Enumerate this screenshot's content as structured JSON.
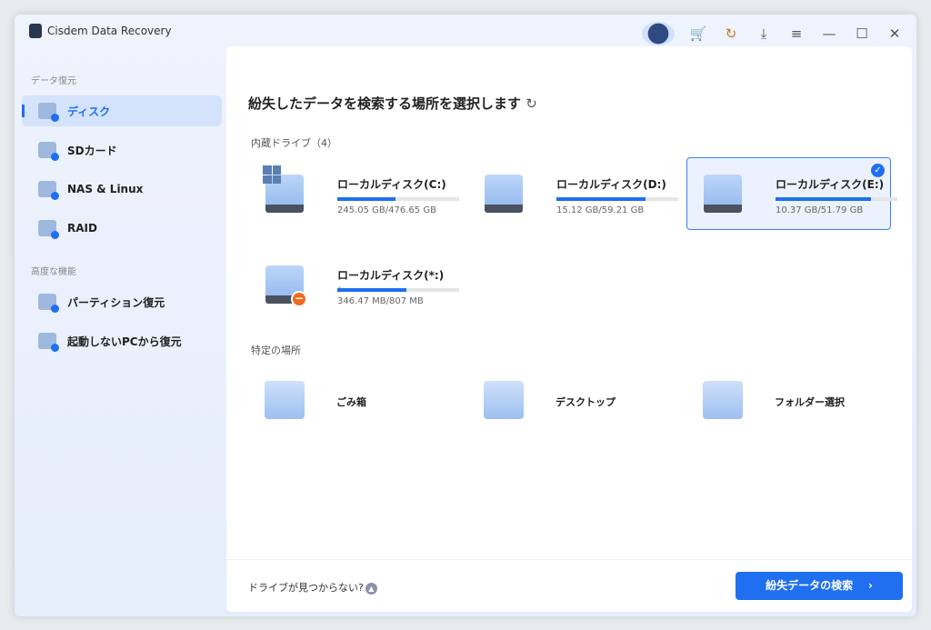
{
  "app": {
    "title": "Cisdem Data Recovery"
  },
  "titlebar": {
    "icons": [
      "mascot-icon",
      "cart-icon",
      "key-icon",
      "download-icon",
      "menu-icon",
      "minimize-icon",
      "maximize-icon",
      "close-icon"
    ],
    "glyphs": [
      "🛒",
      "↻",
      "⤓",
      "≡",
      "—",
      "☐",
      "✕"
    ]
  },
  "sidebar": {
    "section1": "データ復元",
    "items1": [
      {
        "label": "ディスク"
      },
      {
        "label": "SDカード"
      },
      {
        "label": "NAS & Linux"
      },
      {
        "label": "RAID"
      }
    ],
    "section2": "高度な機能",
    "items2": [
      {
        "label": "パーティション復元"
      },
      {
        "label": "起動しないPCから復元"
      }
    ]
  },
  "main": {
    "title": "紛失したデータを検索する場所を選択します",
    "refresh": "↻",
    "drives_label": "内蔵ドライブ（4）",
    "drives": [
      {
        "name": "ローカルディスク(C:)",
        "size": "245.05 GB/476.65 GB",
        "used": 0.48
      },
      {
        "name": "ローカルディスク(D:)",
        "size": "15.12 GB/59.21 GB",
        "used": 0.73
      },
      {
        "name": "ローカルディスク(E:)",
        "size": "10.37 GB/51.79 GB",
        "used": 0.78,
        "selected": true
      },
      {
        "name": "ローカルディスク(*:)",
        "size": "346.47 MB/807 MB",
        "used": 0.57
      }
    ],
    "help_mark": "?",
    "locations_label": "特定の場所",
    "locations": [
      {
        "name": "ごみ箱"
      },
      {
        "name": "デスクトップ"
      },
      {
        "name": "フォルダー選択"
      }
    ],
    "footer": {
      "help": "ドライブが見つからない?",
      "scan": "紛失データの検索",
      "scan_arrow": "›"
    }
  },
  "colors": {
    "accent": "#1f6ff0",
    "warning": "#f26b1d"
  }
}
